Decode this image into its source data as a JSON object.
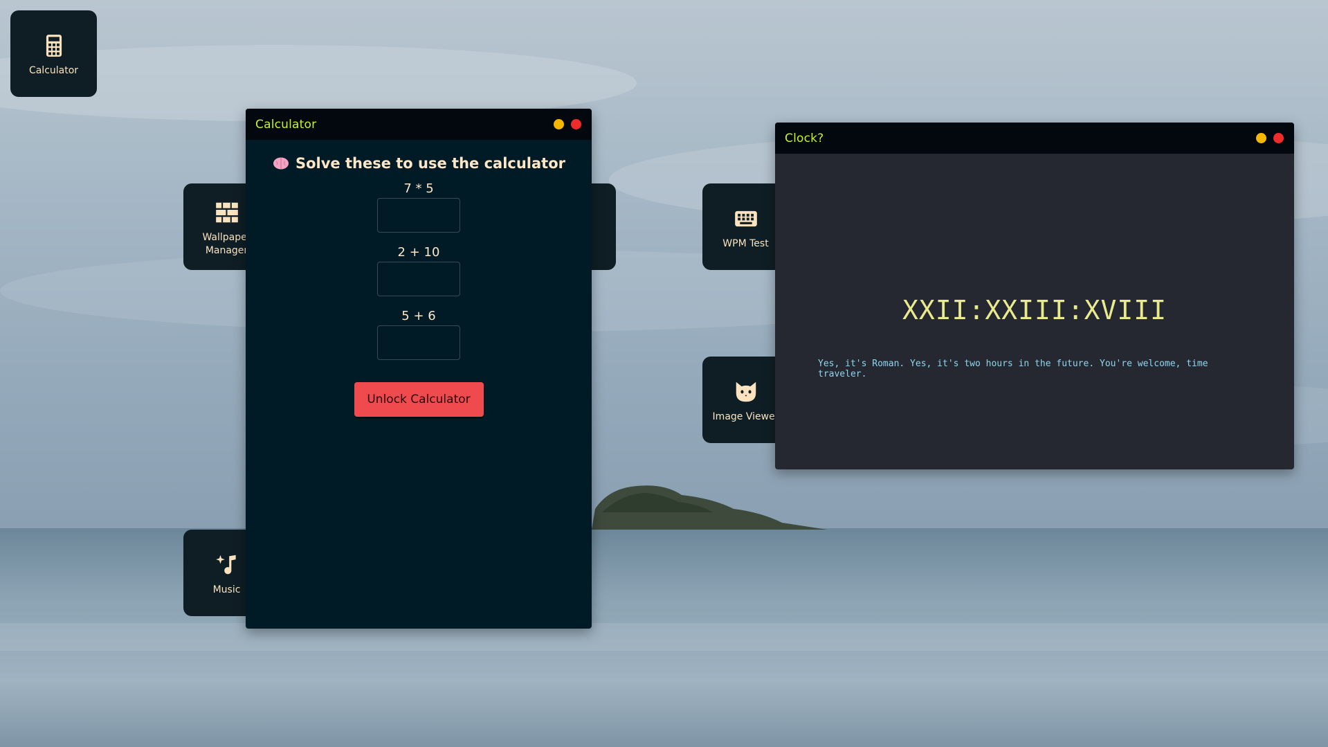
{
  "desktop": {
    "icons": [
      {
        "id": "calculator",
        "label": "Calculator",
        "icon": "calculator-icon"
      },
      {
        "id": "wallpaper",
        "label": "Wallpaper Manager",
        "icon": "wallpaper-icon"
      },
      {
        "id": "music",
        "label": "Music",
        "icon": "music-icon"
      },
      {
        "id": "wpm",
        "label": "WPM Test",
        "icon": "keyboard-icon"
      },
      {
        "id": "image",
        "label": "Image Viewer",
        "icon": "cat-icon"
      }
    ]
  },
  "calculator_window": {
    "title": "Calculator",
    "heading": "Solve these to use the calculator",
    "heading_icon": "brain-icon",
    "questions": [
      {
        "label": "7 * 5",
        "value": ""
      },
      {
        "label": "2 + 10",
        "value": ""
      },
      {
        "label": "5 + 6",
        "value": ""
      }
    ],
    "unlock_label": "Unlock Calculator"
  },
  "clock_window": {
    "title": "Clock?",
    "time": "XXII:XXIII:XVIII",
    "note": "Yes, it's Roman. Yes, it's two hours in the future. You're welcome, time traveler."
  },
  "colors": {
    "window_title": "#c8f41e",
    "minimize": "#f5b800",
    "close": "#ef2b2b",
    "unlock_button": "#ef4a4e",
    "clock_time": "#e9ea8e",
    "clock_note": "#8ed6ef"
  }
}
